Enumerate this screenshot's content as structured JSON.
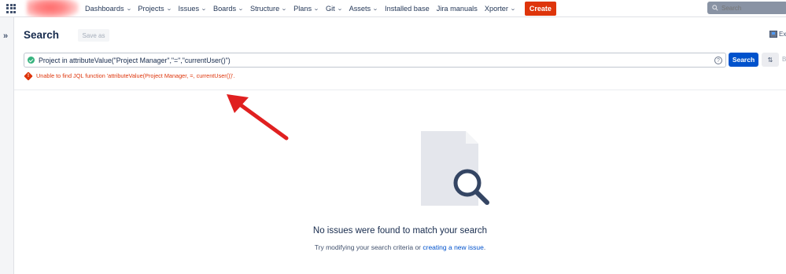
{
  "topbar": {
    "nav_items": [
      {
        "label": "Dashboards",
        "has_dropdown": true
      },
      {
        "label": "Projects",
        "has_dropdown": true
      },
      {
        "label": "Issues",
        "has_dropdown": true
      },
      {
        "label": "Boards",
        "has_dropdown": true
      },
      {
        "label": "Structure",
        "has_dropdown": true
      },
      {
        "label": "Plans",
        "has_dropdown": true
      },
      {
        "label": "Git",
        "has_dropdown": true
      },
      {
        "label": "Assets",
        "has_dropdown": true
      },
      {
        "label": "Installed base",
        "has_dropdown": false
      },
      {
        "label": "Jira manuals",
        "has_dropdown": false
      },
      {
        "label": "Xporter",
        "has_dropdown": true
      }
    ],
    "create_label": "Create",
    "search_placeholder": "Search",
    "icons": {
      "app_switcher": "grid-icon",
      "search": "search-icon"
    }
  },
  "sidebar": {
    "expand_glyph": "»"
  },
  "header": {
    "title": "Search",
    "save_as_label": "Save as",
    "export_label": "Ex"
  },
  "jql": {
    "query": "Project in attributeValue(\"Project Manager\",\"=\",\"currentUser()\")",
    "help_glyph": "?",
    "search_button": "Search",
    "switch_glyph": "⇅",
    "basic_label": "B",
    "error": "Unable to find JQL function 'attributeValue(Project Manager, =, currentUser())'."
  },
  "empty_state": {
    "title": "No issues were found to match your search",
    "subtitle_prefix": "Try modifying your search criteria or ",
    "subtitle_link": "creating a new issue",
    "subtitle_suffix": "."
  },
  "colors": {
    "create": "#de350b",
    "primary": "#0052cc",
    "error": "#de350b",
    "valid": "#36b37e",
    "annotation_arrow": "#e02020"
  }
}
